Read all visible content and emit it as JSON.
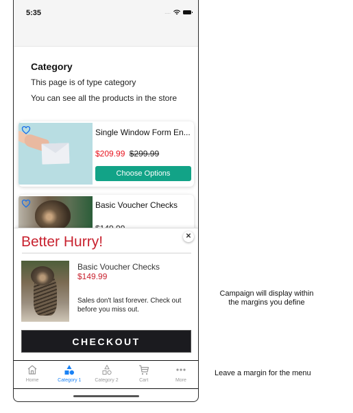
{
  "status_bar": {
    "time": "5:35",
    "signal": "....",
    "icons": [
      "wifi-icon",
      "battery-icon"
    ]
  },
  "page": {
    "title": "Category",
    "description_line1": "This page is of type category",
    "description_line2": "You can see all the products in the store"
  },
  "products": [
    {
      "title": "Single Window Form En...",
      "sale_price": "$209.99",
      "original_price": "$299.99",
      "button_label": "Choose Options",
      "image": "envelope-in-hand",
      "favorite_icon": "heart-icon"
    },
    {
      "title": "Basic Voucher Checks",
      "price": "$149.99",
      "image": "kitten",
      "favorite_icon": "heart-icon"
    }
  ],
  "campaign": {
    "title": "Better Hurry!",
    "close_label": "✕",
    "product_name": "Basic Voucher Checks",
    "product_price": "$149.99",
    "message": "Sales don't last forever. Check out before you miss out.",
    "checkout_label": "CHECKOUT"
  },
  "tab_bar": {
    "active_index": 1,
    "items": [
      {
        "label": "Home",
        "icon": "home-icon"
      },
      {
        "label": "Category 1",
        "icon": "shapes-filled-icon"
      },
      {
        "label": "Category 2",
        "icon": "shapes-outline-icon"
      },
      {
        "label": "Cart",
        "icon": "cart-icon"
      },
      {
        "label": "More",
        "icon": "more-icon"
      }
    ]
  },
  "annotations": {
    "campaign_note": "Campaign will display within the margins you define",
    "menu_note": "Leave a margin for the menu"
  },
  "colors": {
    "accent_blue": "#1a82f5",
    "sale_red": "#e8141e",
    "campaign_red": "#c8222f",
    "button_green": "#12a387",
    "checkout_dark": "#1b1b1f"
  }
}
